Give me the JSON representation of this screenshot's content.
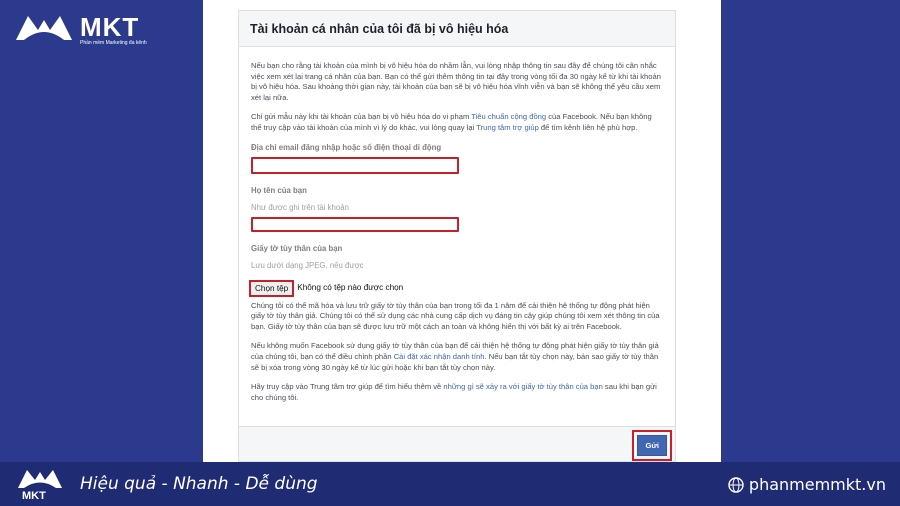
{
  "brand": {
    "name": "MKT",
    "tagline": "Phần mềm Marketing đa kênh",
    "slogan": "Hiệu quả - Nhanh  - Dễ dùng",
    "website": "phanmemmkt.vn"
  },
  "form": {
    "title": "Tài khoản cá nhân của tôi đã bị vô hiệu hóa",
    "intro": "Nếu bạn cho rằng tài khoản của mình bị vô hiệu hóa do nhầm lẫn, vui lòng nhập thông tin sau đây để chúng tôi cân nhắc việc xem xét lại trang cá nhân của bạn. Bạn có thể gửi thêm thông tin tại đây trong vòng tối đa 30 ngày kể từ khi tài khoản bị vô hiệu hóa. Sau khoảng thời gian này, tài khoản của bạn sẽ bị vô hiệu hóa vĩnh viễn và bạn sẽ không thể yêu cầu xem xét lại nữa.",
    "note_part1": "Chỉ gửi mẫu này khi tài khoản của bạn bị vô hiệu hóa do vi phạm ",
    "note_link1": "Tiêu chuẩn cộng đồng",
    "note_part2": " của Facebook. Nếu bạn không thể truy cập vào tài khoản của mình vì lý do khác, vui lòng quay lại ",
    "note_link2": "Trung tâm trợ giúp",
    "note_part3": " để tìm kênh liên hệ phù hợp.",
    "email_label": "Địa chỉ email đăng nhập hoặc số điện thoại di động",
    "name_label": "Họ tên của bạn",
    "name_hint": "Như được ghi trên tài khoản",
    "id_label": "Giấy tờ tùy thân của bạn",
    "id_hint": "Lưu dưới dạng JPEG, nếu được",
    "file_button": "Chọn tệp",
    "file_status": "Không có tệp nào được chọn",
    "p_storage": "Chúng tôi có thể mã hóa và lưu trữ giấy tờ tùy thân của bạn trong tối đa 1 năm để cải thiện hệ thống tự động phát hiện giấy tờ tùy thân giả. Chúng tôi có thể sử dụng các nhà cung cấp dịch vụ đáng tin cậy giúp chúng tôi xem xét thông tin của bạn. Giấy tờ tùy thân của bạn sẽ được lưu trữ một cách an toàn và không hiển thị với bất kỳ ai trên Facebook.",
    "p_settings_1": "Nếu không muốn Facebook sử dụng giấy tờ tùy thân của bạn để cải thiện hệ thống tự động phát hiện giấy tờ tùy thân giả của chúng tôi, bạn có thể điều chỉnh phần ",
    "p_settings_link": "Cài đặt xác nhận danh tính",
    "p_settings_2": ". Nếu bạn tắt tùy chọn này, bản sao giấy tờ tùy thân sẽ bị xóa trong vòng 30 ngày kể từ lúc gửi hoặc khi bạn tắt tùy chọn này.",
    "p_help_1": "Hãy truy cập vào Trung tâm trợ giúp để tìm hiểu thêm về ",
    "p_help_link": "những gì sẽ xảy ra với giấy tờ tùy thân của bạn",
    "p_help_2": " sau khi bạn gửi cho chúng tôi.",
    "submit": "Gửi"
  },
  "colors": {
    "background": "#2b3a8c",
    "bottom_bar": "#1f2b73",
    "highlight": "#c8202a",
    "facebook_blue": "#4267b2"
  }
}
